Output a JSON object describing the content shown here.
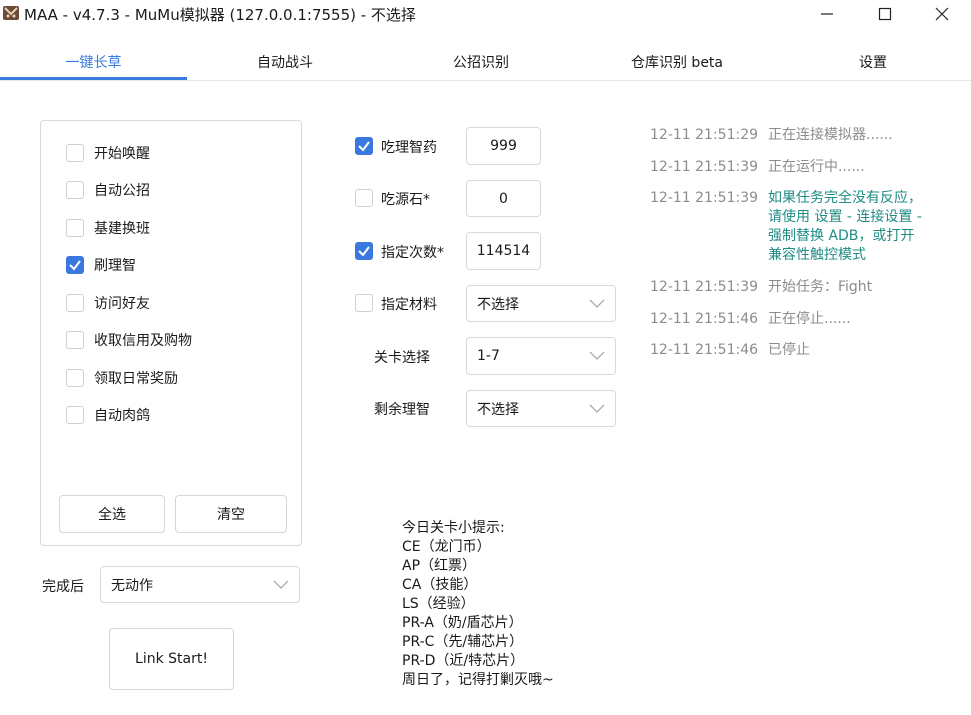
{
  "window": {
    "title": "MAA - v4.7.3 - MuMu模拟器 (127.0.0.1:7555) - 不选择",
    "minimize_icon": "minimize-icon",
    "maximize_icon": "maximize-icon",
    "close_icon": "close-icon"
  },
  "tabs": [
    {
      "label": "一键长草",
      "active": true
    },
    {
      "label": "自动战斗",
      "active": false
    },
    {
      "label": "公招识别",
      "active": false
    },
    {
      "label": "仓库识别 beta",
      "active": false
    },
    {
      "label": "设置",
      "active": false
    }
  ],
  "tasks": [
    {
      "label": "开始唤醒",
      "checked": false
    },
    {
      "label": "自动公招",
      "checked": false
    },
    {
      "label": "基建换班",
      "checked": false
    },
    {
      "label": "刷理智",
      "checked": true
    },
    {
      "label": "访问好友",
      "checked": false
    },
    {
      "label": "收取信用及购物",
      "checked": false
    },
    {
      "label": "领取日常奖励",
      "checked": false
    },
    {
      "label": "自动肉鸽",
      "checked": false
    }
  ],
  "task_buttons": {
    "select_all": "全选",
    "clear": "清空"
  },
  "after_complete": {
    "label": "完成后",
    "value": "无动作"
  },
  "start_button": "Link Start!",
  "options": {
    "medicine": {
      "label": "吃理智药",
      "checked": true,
      "value": "999"
    },
    "stone": {
      "label": "吃源石*",
      "checked": false,
      "value": "0"
    },
    "times": {
      "label": "指定次数*",
      "checked": true,
      "value": "114514"
    },
    "material": {
      "label": "指定材料",
      "checked": false,
      "value": "不选择"
    },
    "stage": {
      "label": "关卡选择",
      "value": "1-7"
    },
    "remaining": {
      "label": "剩余理智",
      "value": "不选择"
    }
  },
  "tips": [
    "今日关卡小提示:",
    "CE（龙门币）",
    "AP（红票）",
    "CA（技能）",
    "LS（经验）",
    "PR-A（奶/盾芯片）",
    "PR-C（先/辅芯片）",
    "PR-D（近/特芯片）",
    "周日了，记得打剿灭哦~"
  ],
  "logs": [
    {
      "time": "12-11  21:51:29",
      "lines": [
        "正在连接模拟器......"
      ],
      "color": "#8c8c8c"
    },
    {
      "time": "12-11  21:51:39",
      "lines": [
        "正在运行中......"
      ],
      "color": "#8c8c8c"
    },
    {
      "time": "12-11  21:51:39",
      "lines": [
        "如果任务完全没有反应，",
        "请使用 设置 - 连接设置 -",
        "强制替换 ADB，或打开",
        "兼容性触控模式"
      ],
      "color": "#1f8c84"
    },
    {
      "time": "12-11  21:51:39",
      "lines": [
        "开始任务：Fight"
      ],
      "color": "#8c8c8c"
    },
    {
      "time": "12-11  21:51:46",
      "lines": [
        "正在停止......"
      ],
      "color": "#8c8c8c"
    },
    {
      "time": "12-11  21:51:46",
      "lines": [
        "已停止"
      ],
      "color": "#8c8c8c"
    }
  ],
  "colors": {
    "accent": "#3a7be0",
    "log_info": "#8c8c8c",
    "log_warn": "#1f8c84"
  }
}
